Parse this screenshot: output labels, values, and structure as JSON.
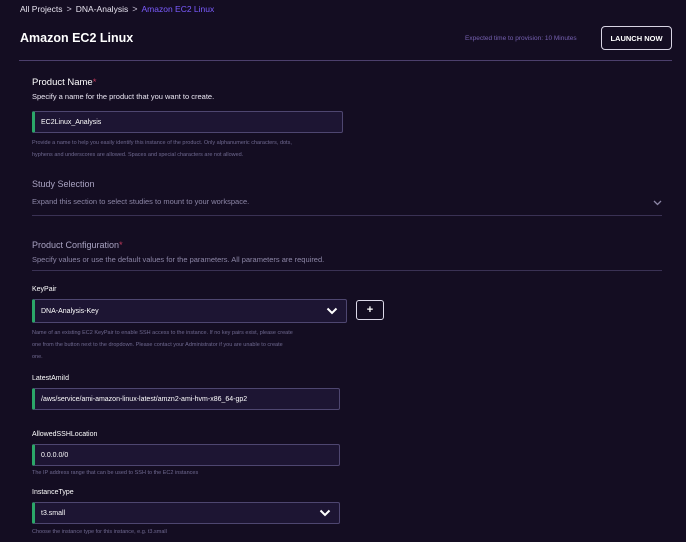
{
  "breadcrumb": {
    "items": [
      "All Projects",
      "DNA-Analysis"
    ],
    "separator": ">",
    "current": "Amazon EC2 Linux"
  },
  "header": {
    "title": "Amazon EC2 Linux",
    "provision_text": "Expected time to provision: 10 Minutes",
    "launch_label": "LAUNCH NOW"
  },
  "product_name": {
    "title": "Product Name",
    "required_mark": "*",
    "description": "Specify a name for the product that you want to create.",
    "value": "EC2Linux_Analysis",
    "help_line1": "Provide a name to help you easily identify this instance of the product. Only alphanumeric characters, dots,",
    "help_line2": "hyphens and underscores are allowed. Spaces and special characters are not allowed."
  },
  "study_selection": {
    "title": "Study Selection",
    "description": "Expand this section to select studies to mount to your workspace."
  },
  "product_configuration": {
    "title": "Product Configuration",
    "required_mark": "*",
    "description": "Specify values or use the default values for the parameters. All parameters are required."
  },
  "keypair": {
    "label": "KeyPair",
    "value": "DNA-Analysis-Key",
    "add_label": "+",
    "help_line1": "Name of an existing EC2 KeyPair to enable SSH access to the instance. If no key pairs exist, please create",
    "help_line2": "one from the button next to the dropdown. Please contact your Administrator if you are unable to create",
    "help_line3": "one."
  },
  "latest_ami": {
    "label": "LatestAmiId",
    "value": "/aws/service/ami-amazon-linux-latest/amzn2-ami-hvm-x86_64-gp2"
  },
  "allowed_ssh": {
    "label": "AllowedSSHLocation",
    "value": "0.0.0.0/0",
    "help": "The IP address range that can be used to SSH to the EC2 instances"
  },
  "instance_type": {
    "label": "InstanceType",
    "value": "t3.small",
    "help": "Choose the instance type for this instance, e.g. t3.small"
  },
  "colors": {
    "background": "#140d22",
    "accent": "#7b5cff",
    "required": "#c0395a",
    "input_indicator": "#2ba769"
  },
  "icons": {
    "chevron": "chevron-down-icon",
    "plus": "plus-icon"
  }
}
